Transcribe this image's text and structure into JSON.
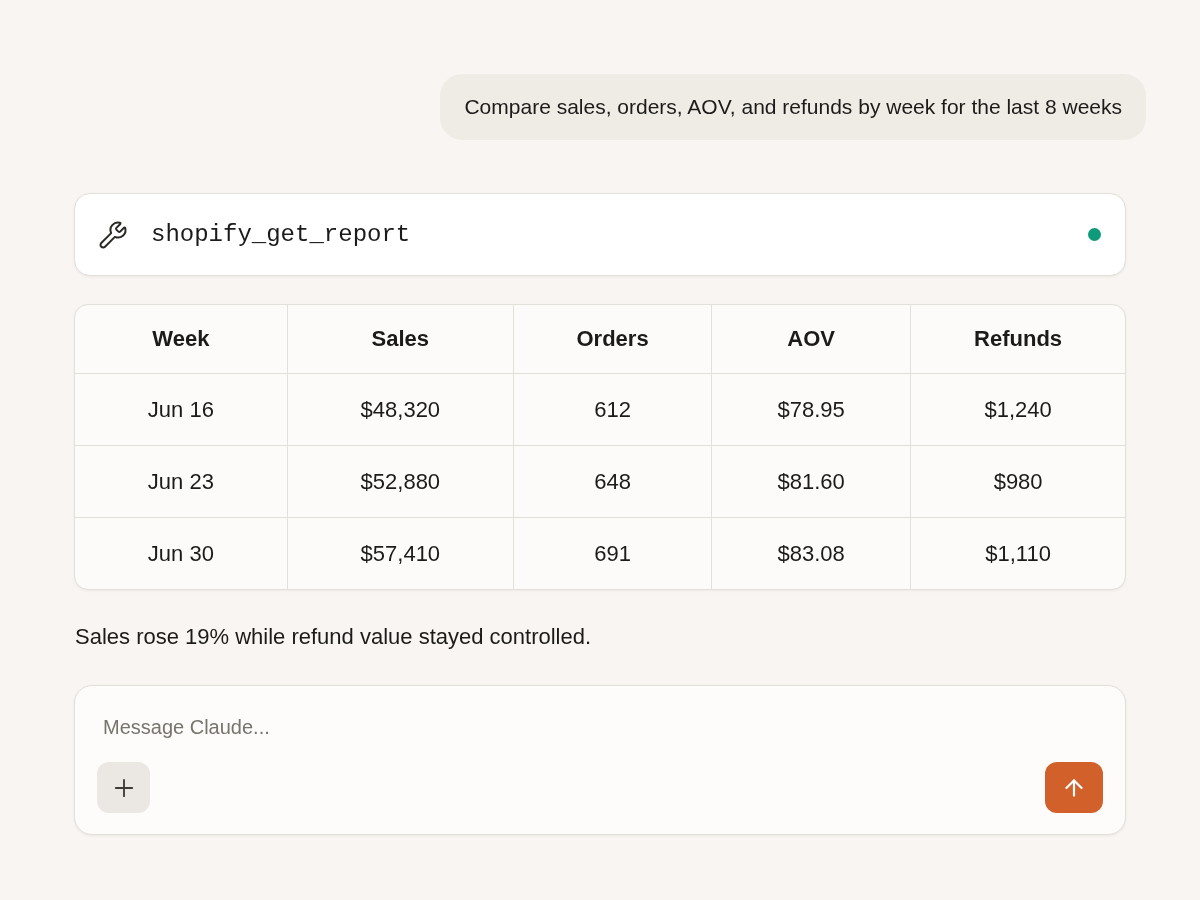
{
  "messages": [
    {
      "kind": "user",
      "text": "Compare sales, orders, AOV, and refunds by week for the last 8 weeks"
    },
    {
      "kind": "tool_call",
      "name": "shopify_get_report",
      "complete": true
    },
    {
      "kind": "table",
      "columns": [
        "Week",
        "Sales",
        "Orders",
        "AOV",
        "Refunds"
      ],
      "rows": [
        [
          "Jun 16",
          "$48,320",
          "612",
          "$78.95",
          "$1,240"
        ],
        [
          "Jun 23",
          "$52,880",
          "648",
          "$81.60",
          "$980"
        ],
        [
          "Jun 30",
          "$57,410",
          "691",
          "$83.08",
          "$1,110"
        ]
      ]
    },
    {
      "kind": "assistant",
      "text": "Sales rose 19% while refund value stayed controlled."
    }
  ],
  "composer": {
    "placeholder": "Message Claude..."
  }
}
